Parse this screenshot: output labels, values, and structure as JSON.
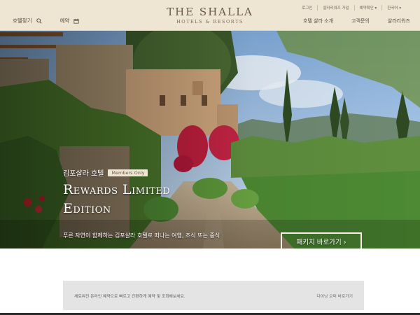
{
  "header": {
    "brand_name": "THE SHALLA",
    "brand_sub": "HOTELS & RESORTS",
    "left": [
      {
        "label": "호텔찾기",
        "icon": "search-icon"
      },
      {
        "label": "예약",
        "icon": "calendar-icon"
      }
    ],
    "util": [
      "로그인",
      "샬라리워즈 가입",
      "예약확인 ▾",
      "한국어 ▾"
    ],
    "nav": [
      "호텔 샬라 소개",
      "고객문의",
      "샬라리워즈"
    ]
  },
  "hero": {
    "pre_title": "김포샬라 호텔",
    "badge": "Members Only",
    "title_line1": "Rewards Limited",
    "title_line2": "Edition",
    "description": "푸른 자연이 함께하는 김포샬라 호텔로 떠나는 여행, 조식 또는 중식",
    "cta": "패키지 바로가기 ›"
  },
  "infobar": {
    "text": "새로워진 온라인 예약으로 빠르고 간편하게 예약 및 조회해보세요.",
    "link": "다이닝 오퍼 바로가기"
  }
}
